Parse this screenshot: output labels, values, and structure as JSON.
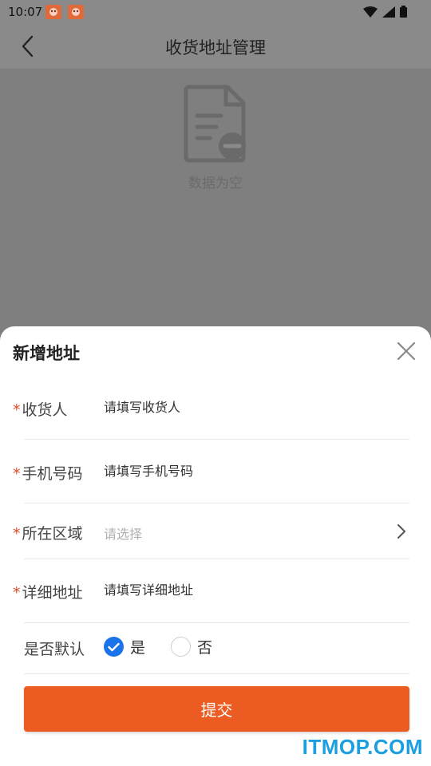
{
  "status_bar": {
    "time": "10:07",
    "notification_icons": [
      "app-notification-icon",
      "app-notification-icon"
    ]
  },
  "header": {
    "title": "收货地址管理",
    "back_icon": "chevron-left-icon"
  },
  "empty_state": {
    "icon": "empty-document-icon",
    "text": "数据为空"
  },
  "sheet": {
    "title": "新增地址",
    "close_icon": "close-icon",
    "required_mark": "*",
    "fields": {
      "receiver": {
        "label": "收货人",
        "placeholder": "请填写收货人",
        "value": ""
      },
      "phone": {
        "label": "手机号码",
        "placeholder": "请填写手机号码",
        "value": ""
      },
      "region": {
        "label": "所在区域",
        "placeholder": "请选择"
      },
      "detail": {
        "label": "详细地址",
        "placeholder": "请填写详细地址",
        "value": ""
      }
    },
    "default": {
      "label": "是否默认",
      "yes": "是",
      "no": "否",
      "selected": "是"
    },
    "submit_label": "提交"
  },
  "watermark": "ITMOP.COM",
  "colors": {
    "accent": "#eb5b22",
    "check": "#1a73e8",
    "required": "#e04a2a",
    "watermark": "#1a9fe0"
  }
}
